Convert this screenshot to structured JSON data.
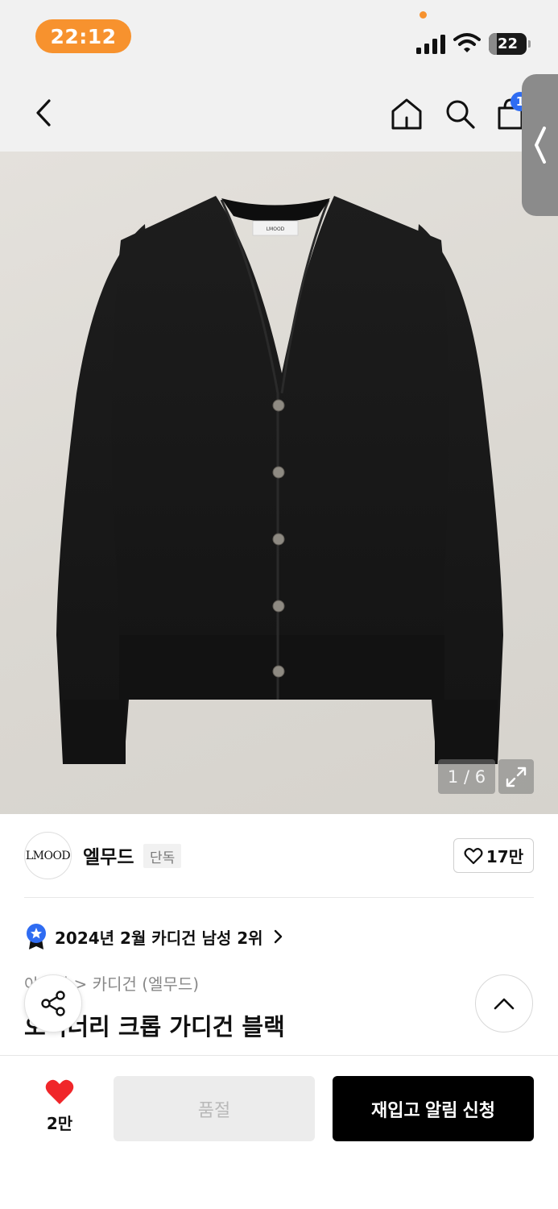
{
  "status_bar": {
    "time": "22:12",
    "battery": "22",
    "battery_level_percent": 22,
    "icons": [
      "signal-icon",
      "wifi-icon",
      "battery-icon"
    ]
  },
  "nav": {
    "cart_count": "1",
    "icons": [
      "back-icon",
      "home-icon",
      "search-icon",
      "cart-icon",
      "side-panel-handle"
    ]
  },
  "gallery": {
    "image_label": "LMOOD",
    "counter": "1 / 6"
  },
  "brand": {
    "logo_text": "LMOOD",
    "name": "엘무드",
    "tag": "단독",
    "like_count": "17만"
  },
  "ranking": {
    "text": "2024년 2월 카디건 남성 2위"
  },
  "breadcrumb": {
    "text": "아우터 > 카디건 (엘무드)"
  },
  "product": {
    "title": "오디너리 크롭 가디건 블랙"
  },
  "bottom_bar": {
    "wish_count": "2만",
    "soldout_label": "품절",
    "restock_label": "재입고 알림 신청"
  },
  "colors": {
    "accent_orange": "#f7922e",
    "badge_blue": "#2f6cf2",
    "heart_red": "#f0262a",
    "primary_black": "#000000"
  }
}
